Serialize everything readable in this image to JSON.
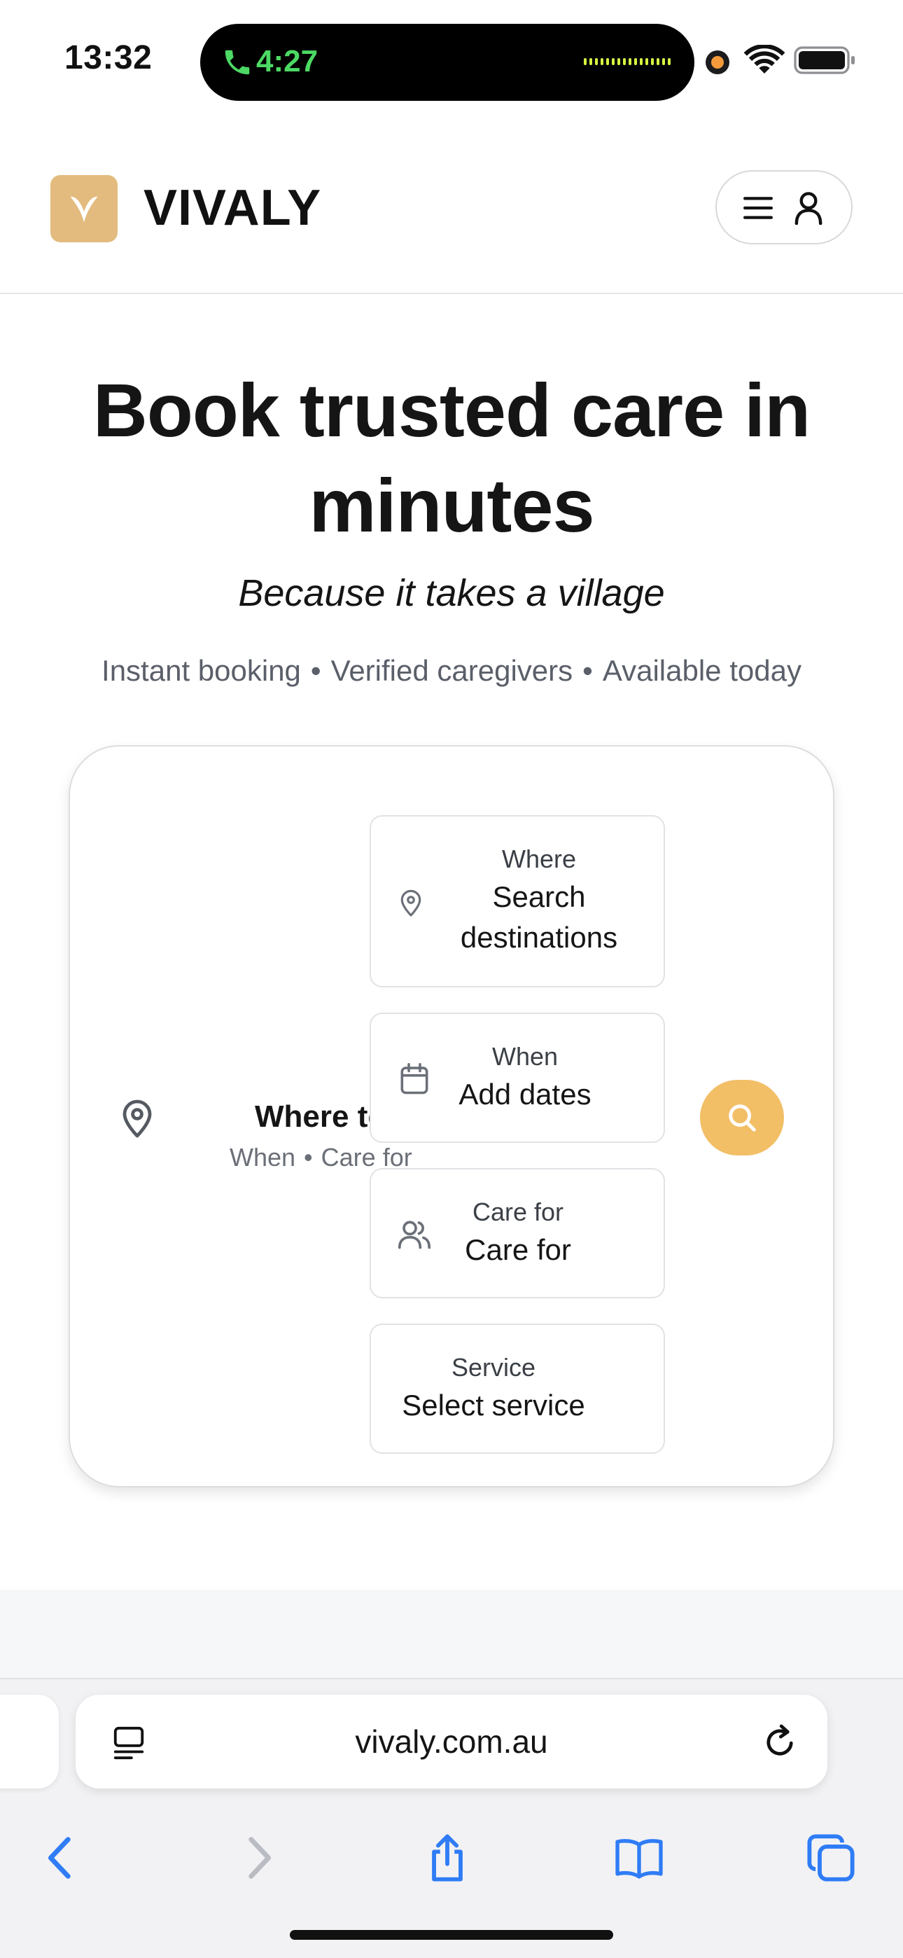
{
  "status_bar": {
    "time": "13:32",
    "call_duration": "4:27",
    "icons": [
      "phone-icon",
      "recording-dot",
      "wifi-icon",
      "battery-icon"
    ]
  },
  "header": {
    "brand": "VIVALY",
    "logo_color": "#e3bb7e",
    "menu_icons": [
      "hamburger-icon",
      "user-icon"
    ]
  },
  "hero": {
    "title": "Book trusted care in minutes",
    "tagline": "Because it takes a village",
    "features": [
      "Instant booking",
      "Verified caregivers",
      "Available today"
    ],
    "separator": "•"
  },
  "search": {
    "compact": {
      "title": "Where to?",
      "subtitle_parts": [
        "When",
        "Care for"
      ]
    },
    "fields": {
      "where": {
        "label": "Where",
        "placeholder": "Search destinations",
        "icon": "map-pin-icon"
      },
      "when": {
        "label": "When",
        "placeholder": "Add dates",
        "icon": "calendar-icon"
      },
      "care_for": {
        "label": "Care for",
        "placeholder": "Care for",
        "icon": "users-icon"
      },
      "service": {
        "label": "Service",
        "placeholder": "Select service"
      }
    },
    "button_icon": "search-icon",
    "accent_color": "#f2be66"
  },
  "browser": {
    "url": "vivaly.com.au",
    "toolbar_icons": [
      "back-icon",
      "forward-icon",
      "share-icon",
      "bookmarks-icon",
      "tabs-icon"
    ]
  }
}
